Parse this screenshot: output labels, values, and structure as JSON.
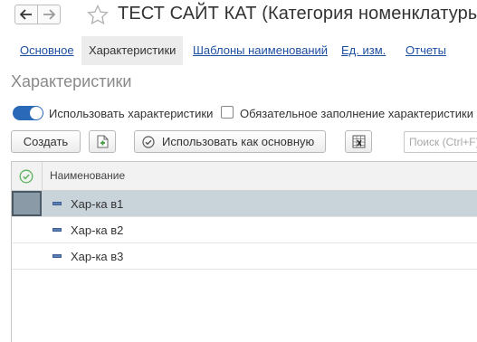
{
  "window": {
    "title": "ТЕСТ САЙТ КАТ (Категория номенклатуры)"
  },
  "tabs": [
    {
      "label": "Основное",
      "active": false
    },
    {
      "label": "Характеристики",
      "active": true
    },
    {
      "label": "Шаблоны наименований",
      "active": false
    },
    {
      "label": "Ед. изм.",
      "active": false
    },
    {
      "label": "Отчеты",
      "active": false
    }
  ],
  "section": {
    "heading": "Характеристики"
  },
  "options": {
    "use_characteristics_label": "Использовать характеристики",
    "use_characteristics_on": true,
    "required_fill_label": "Обязательное заполнение характеристики",
    "required_fill_checked": false
  },
  "toolbar": {
    "create_label": "Создать",
    "use_as_main_label": "Использовать как основную",
    "search_placeholder": "Поиск (Ctrl+F)"
  },
  "table": {
    "column_name": "Наименование",
    "rows": [
      {
        "name": "Хар-ка в1",
        "selected": true
      },
      {
        "name": "Хар-ка в2",
        "selected": false
      },
      {
        "name": "Хар-ка в3",
        "selected": false
      }
    ]
  },
  "colors": {
    "link": "#1d4fa1",
    "toggle_on": "#2a69b8",
    "selection": "#c9d3da"
  }
}
